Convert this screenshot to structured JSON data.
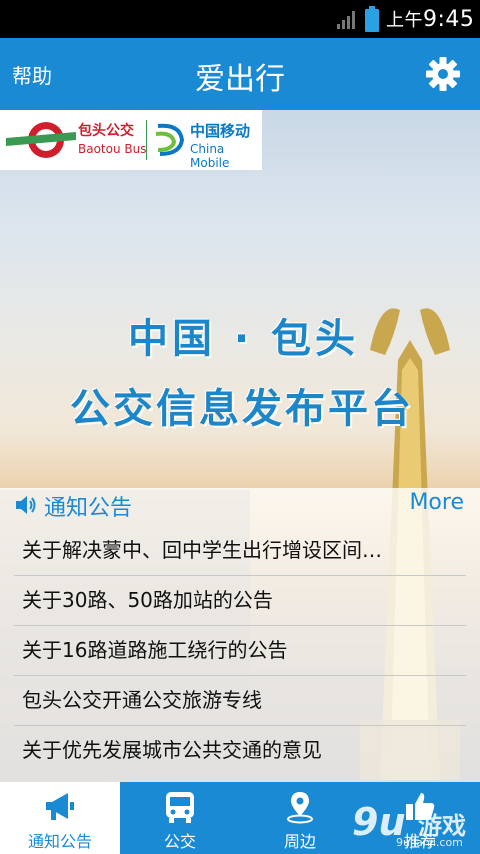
{
  "status_bar": {
    "ampm": "上午",
    "time": "9:45"
  },
  "header": {
    "help_label": "帮助",
    "title": "爱出行",
    "settings_icon": "gear-icon"
  },
  "logos": {
    "bus_cn": "包头公交",
    "bus_en": "Baotou Bus",
    "mobile_cn": "中国移动",
    "mobile_en": "China Mobile"
  },
  "banner": {
    "line1": "中国 · 包头",
    "line2": "公交信息发布平台"
  },
  "notice": {
    "title": "通知公告",
    "more_label": "More",
    "items": [
      "关于解决蒙中、回中学生出行增设区间…",
      "关于30路、50路加站的公告",
      "关于16路道路施工绕行的公告",
      "包头公交开通公交旅游专线",
      "关于优先发展城市公共交通的意见"
    ]
  },
  "bottom_nav": {
    "tabs": [
      {
        "label": "通知公告",
        "icon": "megaphone-icon",
        "active": true
      },
      {
        "label": "公交",
        "icon": "bus-icon",
        "active": false
      },
      {
        "label": "周边",
        "icon": "location-pin-icon",
        "active": false
      },
      {
        "label": "推荐",
        "icon": "thumbs-up-icon",
        "active": false
      }
    ]
  },
  "watermark": {
    "number": "9u",
    "text": "游戏",
    "url": "9ujianji.com"
  },
  "colors": {
    "primary": "#1a8ad4",
    "bus_red": "#d01f2c",
    "mobile_blue": "#0a78c4"
  }
}
